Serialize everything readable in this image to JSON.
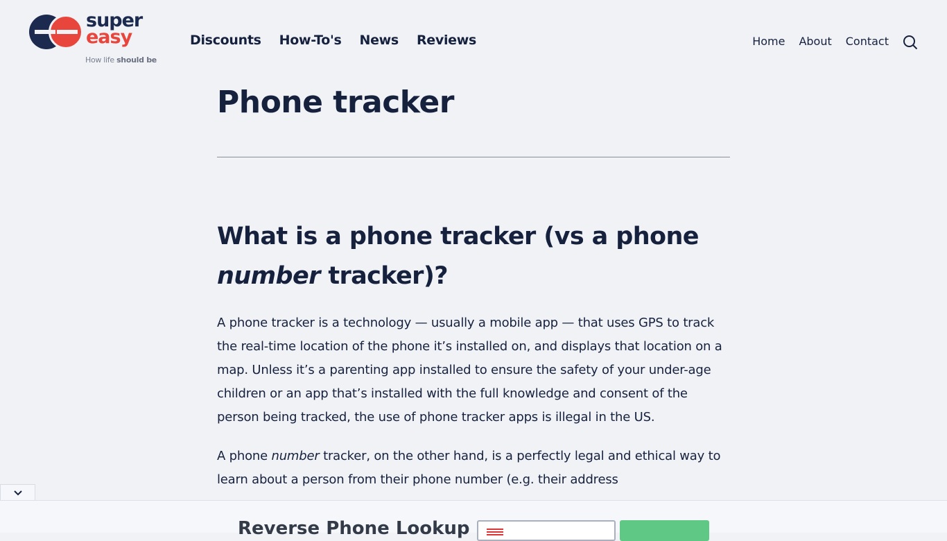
{
  "logo": {
    "word1": "super",
    "word2": "easy",
    "tagline_light": "How life",
    "tagline_bold": "should be"
  },
  "nav": {
    "items": [
      "Discounts",
      "How-To's",
      "News",
      "Reviews"
    ]
  },
  "right_nav": {
    "items": [
      "Home",
      "About",
      "Contact"
    ],
    "search_icon": "search-icon"
  },
  "article": {
    "title": "Phone tracker",
    "heading_part1": "What is a phone tracker (vs a phone ",
    "heading_em": "number",
    "heading_part2": " tracker)?",
    "p1": "A phone tracker is a technology — usually a mobile app — that uses GPS to track the real-time location of the phone it’s installed on, and displays that location on a map. Unless it’s a parenting app installed to ensure the safety of your under-age children or an app that’s installed with the full knowledge and consent of the person being tracked, the use of phone tracker apps is illegal in the US.",
    "p2_a": "A phone ",
    "p2_em": "number",
    "p2_b": " tracker, on the other hand, is a perfectly legal and ethical way to learn about a person from their phone number (e.g. their address"
  },
  "bottom_bar": {
    "title": "Reverse Phone Lookup",
    "collapse_icon": "chevron-down-icon",
    "button_color": "#5fc884"
  }
}
